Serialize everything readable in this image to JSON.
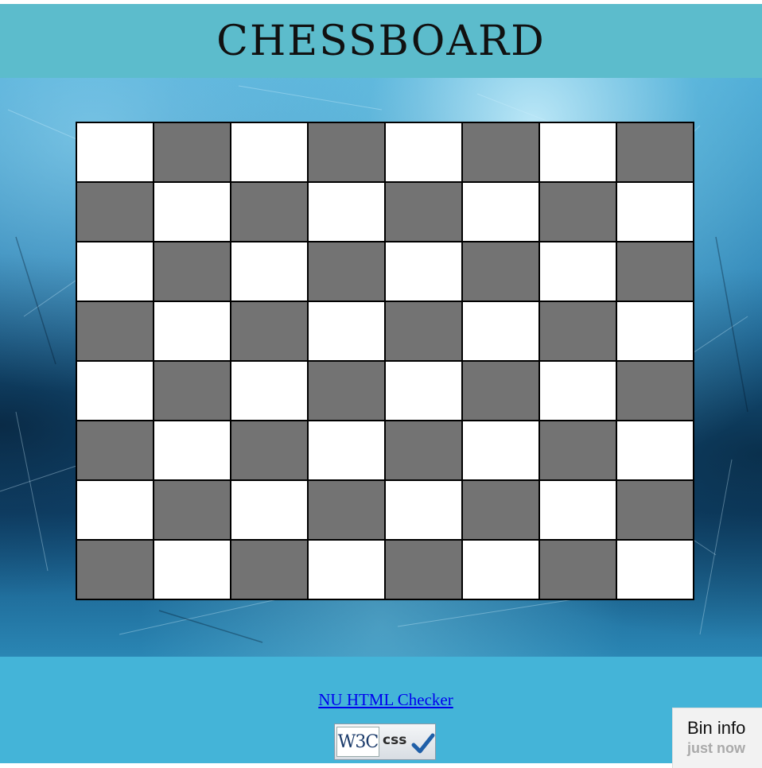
{
  "page": {
    "title": "CHESSBOARD"
  },
  "board": {
    "rows": 8,
    "cols": 8,
    "light_color": "#ffffff",
    "dark_color": "#737373",
    "top_left": "light"
  },
  "footer": {
    "checker_link": "NU HTML Checker",
    "w3c_badge": {
      "logo": "W3C",
      "label": "css",
      "icon": "checkmark-icon"
    }
  },
  "bin_info": {
    "title": "Bin info",
    "time": "just now"
  },
  "colors": {
    "header": "#5cbccc",
    "footer": "#44b4d8",
    "link": "#0000ee"
  }
}
